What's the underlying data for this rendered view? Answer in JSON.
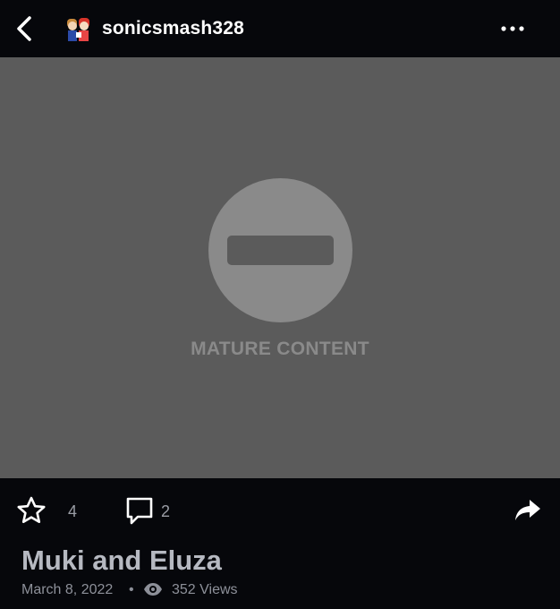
{
  "header": {
    "back_icon": "chevron-left-icon",
    "username": "sonicsmash328",
    "avatar_icon": "user-avatar",
    "more_icon": "more-horizontal-icon"
  },
  "media": {
    "blocked_icon": "no-entry-icon",
    "label": "MATURE CONTENT",
    "background_color": "#5b5b5b"
  },
  "actions": {
    "favorite_icon": "star-outline-icon",
    "favorite_count": "4",
    "comment_icon": "comment-bubble-icon",
    "comment_count": "2",
    "share_icon": "share-arrow-icon"
  },
  "deviation": {
    "title": "Muki and Eluza",
    "date": "March 8, 2022",
    "separator": "•",
    "views_icon": "eye-icon",
    "views": "352 Views"
  },
  "colors": {
    "background": "#06070b",
    "text_primary": "#ffffff",
    "text_secondary": "#b6b9c1"
  }
}
